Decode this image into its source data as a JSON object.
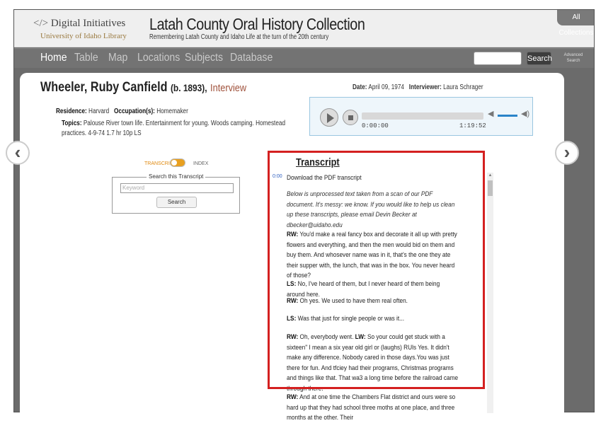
{
  "header": {
    "logo_tag": "</>",
    "logo_text": "Digital Initiatives",
    "logo_sub": "University of Idaho Library",
    "title": "Latah County Oral History Collection",
    "subtitle": "Remembering Latah County and Idaho Life at the turn of the 20th century",
    "all_collections": "All Collections"
  },
  "nav": {
    "items": [
      {
        "label": "Home",
        "active": true
      },
      {
        "label": "Table"
      },
      {
        "label": "Map"
      },
      {
        "label": "Locations"
      },
      {
        "label": "Subjects"
      },
      {
        "label": "Database"
      }
    ],
    "search_button": "Search",
    "advanced_search": "Advanced Search"
  },
  "record": {
    "name": "Wheeler, Ruby Canfield",
    "born": "(b. 1893),",
    "type": "Interview",
    "residence_label": "Residence:",
    "residence": "Harvard",
    "occupation_label": "Occupation(s):",
    "occupation": "Homemaker",
    "topics_label": "Topics:",
    "topics_line1": "Palouse River town life. Entertainment for young. Woods camping. Homestead",
    "topics_line2": "practices. 4-9-74 1.7 hr 10p LS",
    "date_label": "Date:",
    "date": "April 09, 1974",
    "interviewer_label": "Interviewer:",
    "interviewer": "Laura Schrager"
  },
  "player": {
    "current_time": "0:00:00",
    "duration": "1:19:52"
  },
  "toggle": {
    "transcript_label": "TRANSCRIPT",
    "index_label": "INDEX"
  },
  "transcript_search": {
    "legend": "Search this Transcript",
    "placeholder": "Keyword",
    "button": "Search"
  },
  "transcript": {
    "title": "Transcript",
    "timestamp": "0:00",
    "download": "Download the PDF transcript",
    "note": "Below is unprocessed text taken from a scan of our PDF document. It's messy: we know. If you would like to help us clean up these transcripts, please email Devin Becker at dbecker@uidaho.edu",
    "paragraphs": [
      {
        "speaker": "RW:",
        "text": " You'd make a real fancy box and decorate it all up with pretty flowers and everything, and then the men would bid on them and buy them. And whosever name was in it, that's the one they ate their supper with, the lunch, that was in the box. You never heard of those?"
      },
      {
        "speaker": "LS:",
        "text": " No, I've heard of them, but I never heard of them being around here."
      },
      {
        "speaker": "RW:",
        "text": " Oh yes. We used to have them real often."
      },
      {
        "speaker": "LS:",
        "text": " Was that just for single people or was it..."
      },
      {
        "speaker": "RW:",
        "text": " Oh, everybody went. ",
        "speaker2": "LW:",
        "text2": " So your could get stuck with a sixteen\" I mean a six year old girl or (laughs) RUls Yes. It didn't make any difference. Nobody cared in those days.You was just there for fun. And tfciey had their programs, Christmas programs and things like that. That wa3 a long time before the railroad came through there."
      },
      {
        "speaker": "RW:",
        "text": " And at one time the Chambers Flat district and ours were so hard up that they had school three moths at one place, and three months at the other. Their"
      }
    ]
  }
}
